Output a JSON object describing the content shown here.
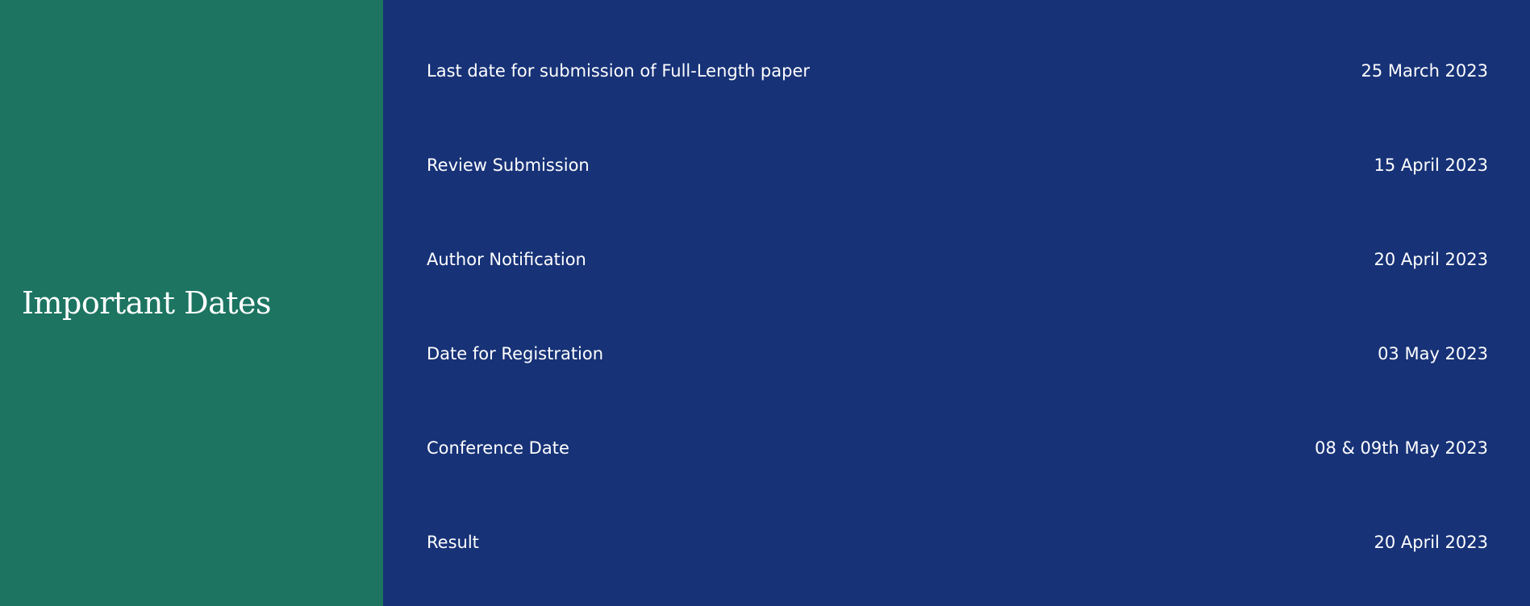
{
  "colors": {
    "left_panel_bg": "#1c7461",
    "right_panel_bg": "#173277",
    "text": "#ffffff"
  },
  "section": {
    "title": "Important Dates"
  },
  "dates": [
    {
      "event": "Last date for submission of Full-Length paper",
      "date": "25 March 2023"
    },
    {
      "event": "Review Submission",
      "date": "15 April 2023"
    },
    {
      "event": "Author Notification",
      "date": "20 April 2023"
    },
    {
      "event": "Date for Registration",
      "date": "03 May 2023"
    },
    {
      "event": "Conference Date",
      "date": "08 & 09th May 2023"
    },
    {
      "event": "Result",
      "date": "20 April 2023"
    }
  ]
}
